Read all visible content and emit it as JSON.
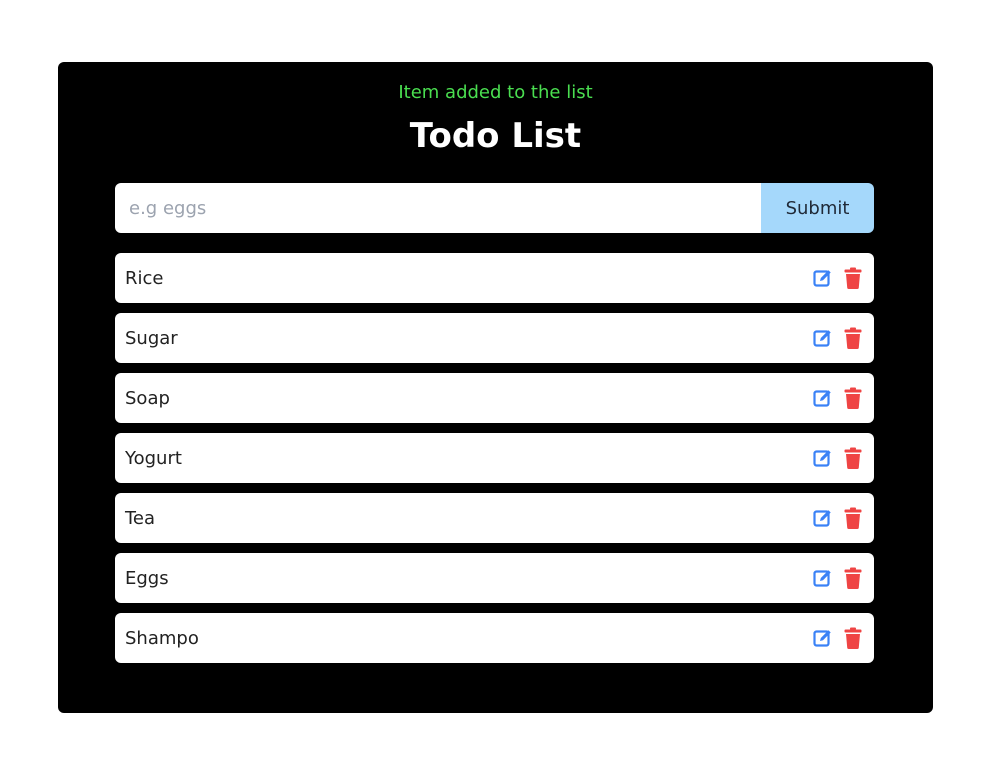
{
  "alert": {
    "text": "Item added to the list",
    "color": "#4ade50"
  },
  "title": "Todo List",
  "form": {
    "input_value": "",
    "placeholder": "e.g eggs",
    "submit_label": "Submit",
    "submit_color": "#a5d8fb"
  },
  "items": [
    {
      "label": "Rice"
    },
    {
      "label": "Sugar"
    },
    {
      "label": "Soap"
    },
    {
      "label": "Yogurt"
    },
    {
      "label": "Tea"
    },
    {
      "label": "Eggs"
    },
    {
      "label": "Shampo"
    }
  ],
  "icons": {
    "edit": "edit-icon",
    "delete": "trash-icon",
    "edit_color": "#3b82f6",
    "delete_color": "#ef4444"
  }
}
